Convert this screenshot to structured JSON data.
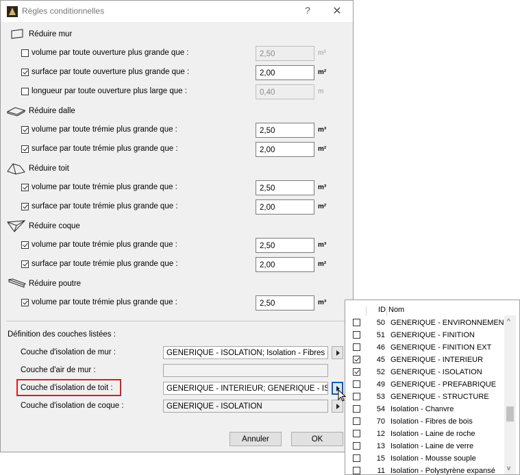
{
  "dialog": {
    "title": "Règles conditionnelles",
    "help": "?",
    "close": "✕"
  },
  "sections": [
    {
      "title": "Réduire mur",
      "icon": "wall-icon",
      "rows": [
        {
          "label": "volume par toute ouverture plus grande que :",
          "checked": false,
          "value": "2,50",
          "unit": "m³",
          "enabled": false
        },
        {
          "label": "surface par toute ouverture plus grande que :",
          "checked": true,
          "value": "2,00",
          "unit": "m²",
          "enabled": true
        },
        {
          "label": "longueur par toute ouverture plus large que :",
          "checked": false,
          "value": "0,40",
          "unit": "m",
          "enabled": false
        }
      ]
    },
    {
      "title": "Réduire dalle",
      "icon": "slab-icon",
      "rows": [
        {
          "label": "volume par toute trémie plus grande que :",
          "checked": true,
          "value": "2,50",
          "unit": "m³",
          "enabled": true
        },
        {
          "label": "surface par toute trémie plus grande que :",
          "checked": true,
          "value": "2,00",
          "unit": "m²",
          "enabled": true
        }
      ]
    },
    {
      "title": "Réduire toit",
      "icon": "roof-icon",
      "rows": [
        {
          "label": "volume par toute trémie plus grande que :",
          "checked": true,
          "value": "2,50",
          "unit": "m³",
          "enabled": true
        },
        {
          "label": "surface par toute trémie plus grande que :",
          "checked": true,
          "value": "2,00",
          "unit": "m²",
          "enabled": true
        }
      ]
    },
    {
      "title": "Réduire coque",
      "icon": "shell-icon",
      "rows": [
        {
          "label": "volume par toute trémie plus grande que :",
          "checked": true,
          "value": "2,50",
          "unit": "m³",
          "enabled": true
        },
        {
          "label": "surface par toute trémie plus grande que :",
          "checked": true,
          "value": "2,00",
          "unit": "m²",
          "enabled": true
        }
      ]
    },
    {
      "title": "Réduire poutre",
      "icon": "beam-icon",
      "rows": [
        {
          "label": "volume par toute trémie plus grande que :",
          "checked": true,
          "value": "2,50",
          "unit": "m³",
          "enabled": true
        }
      ]
    }
  ],
  "layers": {
    "title": "Définition des couches listées :",
    "items": [
      {
        "label": "Couche d'isolation de mur :",
        "value": "GENERIQUE - ISOLATION; Isolation - Fibres de bois"
      },
      {
        "label": "Couche d'air de mur :",
        "value": ""
      },
      {
        "label": "Couche d'isolation de toit :",
        "value": "GENERIQUE - INTERIEUR; GENERIQUE - ISOLATION"
      },
      {
        "label": "Couche d'isolation de coque :",
        "value": "GENERIQUE - ISOLATION"
      }
    ]
  },
  "buttons": {
    "cancel": "Annuler",
    "ok": "OK"
  },
  "popup": {
    "col_id": "ID",
    "col_name": "Nom",
    "rows": [
      {
        "id": "50",
        "name": "GENERIQUE - ENVIRONNEMENT",
        "checked": false
      },
      {
        "id": "51",
        "name": "GENERIQUE - FINITION",
        "checked": false
      },
      {
        "id": "46",
        "name": "GENERIQUE - FINITION EXT",
        "checked": false
      },
      {
        "id": "45",
        "name": "GENERIQUE - INTERIEUR",
        "checked": true
      },
      {
        "id": "52",
        "name": "GENERIQUE - ISOLATION",
        "checked": true
      },
      {
        "id": "49",
        "name": "GENERIQUE - PREFABRIQUE",
        "checked": false
      },
      {
        "id": "53",
        "name": "GENERIQUE - STRUCTURE",
        "checked": false
      },
      {
        "id": "54",
        "name": "Isolation - Chanvre",
        "checked": false
      },
      {
        "id": "70",
        "name": "Isolation - Fibres de bois",
        "checked": false
      },
      {
        "id": "12",
        "name": "Isolation - Laine de roche",
        "checked": false
      },
      {
        "id": "13",
        "name": "Isolation - Laine de verre",
        "checked": false
      },
      {
        "id": "15",
        "name": "Isolation - Mousse souple",
        "checked": false
      },
      {
        "id": "11",
        "name": "Isolation - Polystyrène expansé",
        "checked": false
      }
    ],
    "scroll_up": "^",
    "scroll_down": "v"
  }
}
